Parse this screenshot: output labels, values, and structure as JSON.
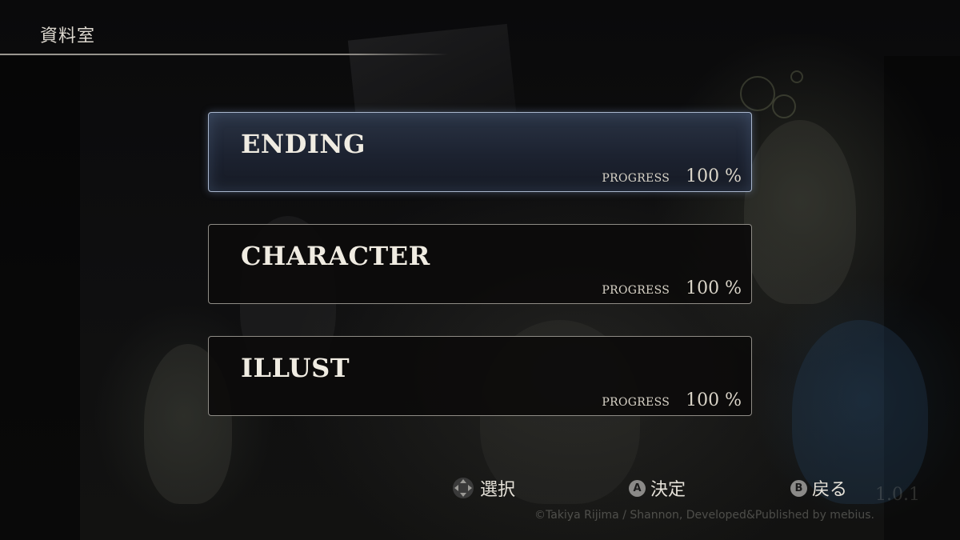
{
  "header": {
    "title": "資料室"
  },
  "menu": {
    "items": [
      {
        "label": "ENDING",
        "progress_label": "PROGRESS",
        "progress_value": "100 %",
        "selected": true
      },
      {
        "label": "CHARACTER",
        "progress_label": "PROGRESS",
        "progress_value": "100 %",
        "selected": false
      },
      {
        "label": "ILLUST",
        "progress_label": "PROGRESS",
        "progress_value": "100 %",
        "selected": false
      }
    ]
  },
  "controls": {
    "select": {
      "icon": "dpad-icon",
      "label": "選択"
    },
    "confirm": {
      "icon": "a-button-icon",
      "button": "A",
      "label": "決定"
    },
    "back": {
      "icon": "b-button-icon",
      "button": "B",
      "label": "戻る"
    }
  },
  "version": "1.0.1",
  "copyright": "©Takiya Rijima / Shannon, Developed&Published by mebius.",
  "colors": {
    "selected_border": "#a9b6cc",
    "item_border": "#8f8c86",
    "text": "#e9e5dc"
  }
}
